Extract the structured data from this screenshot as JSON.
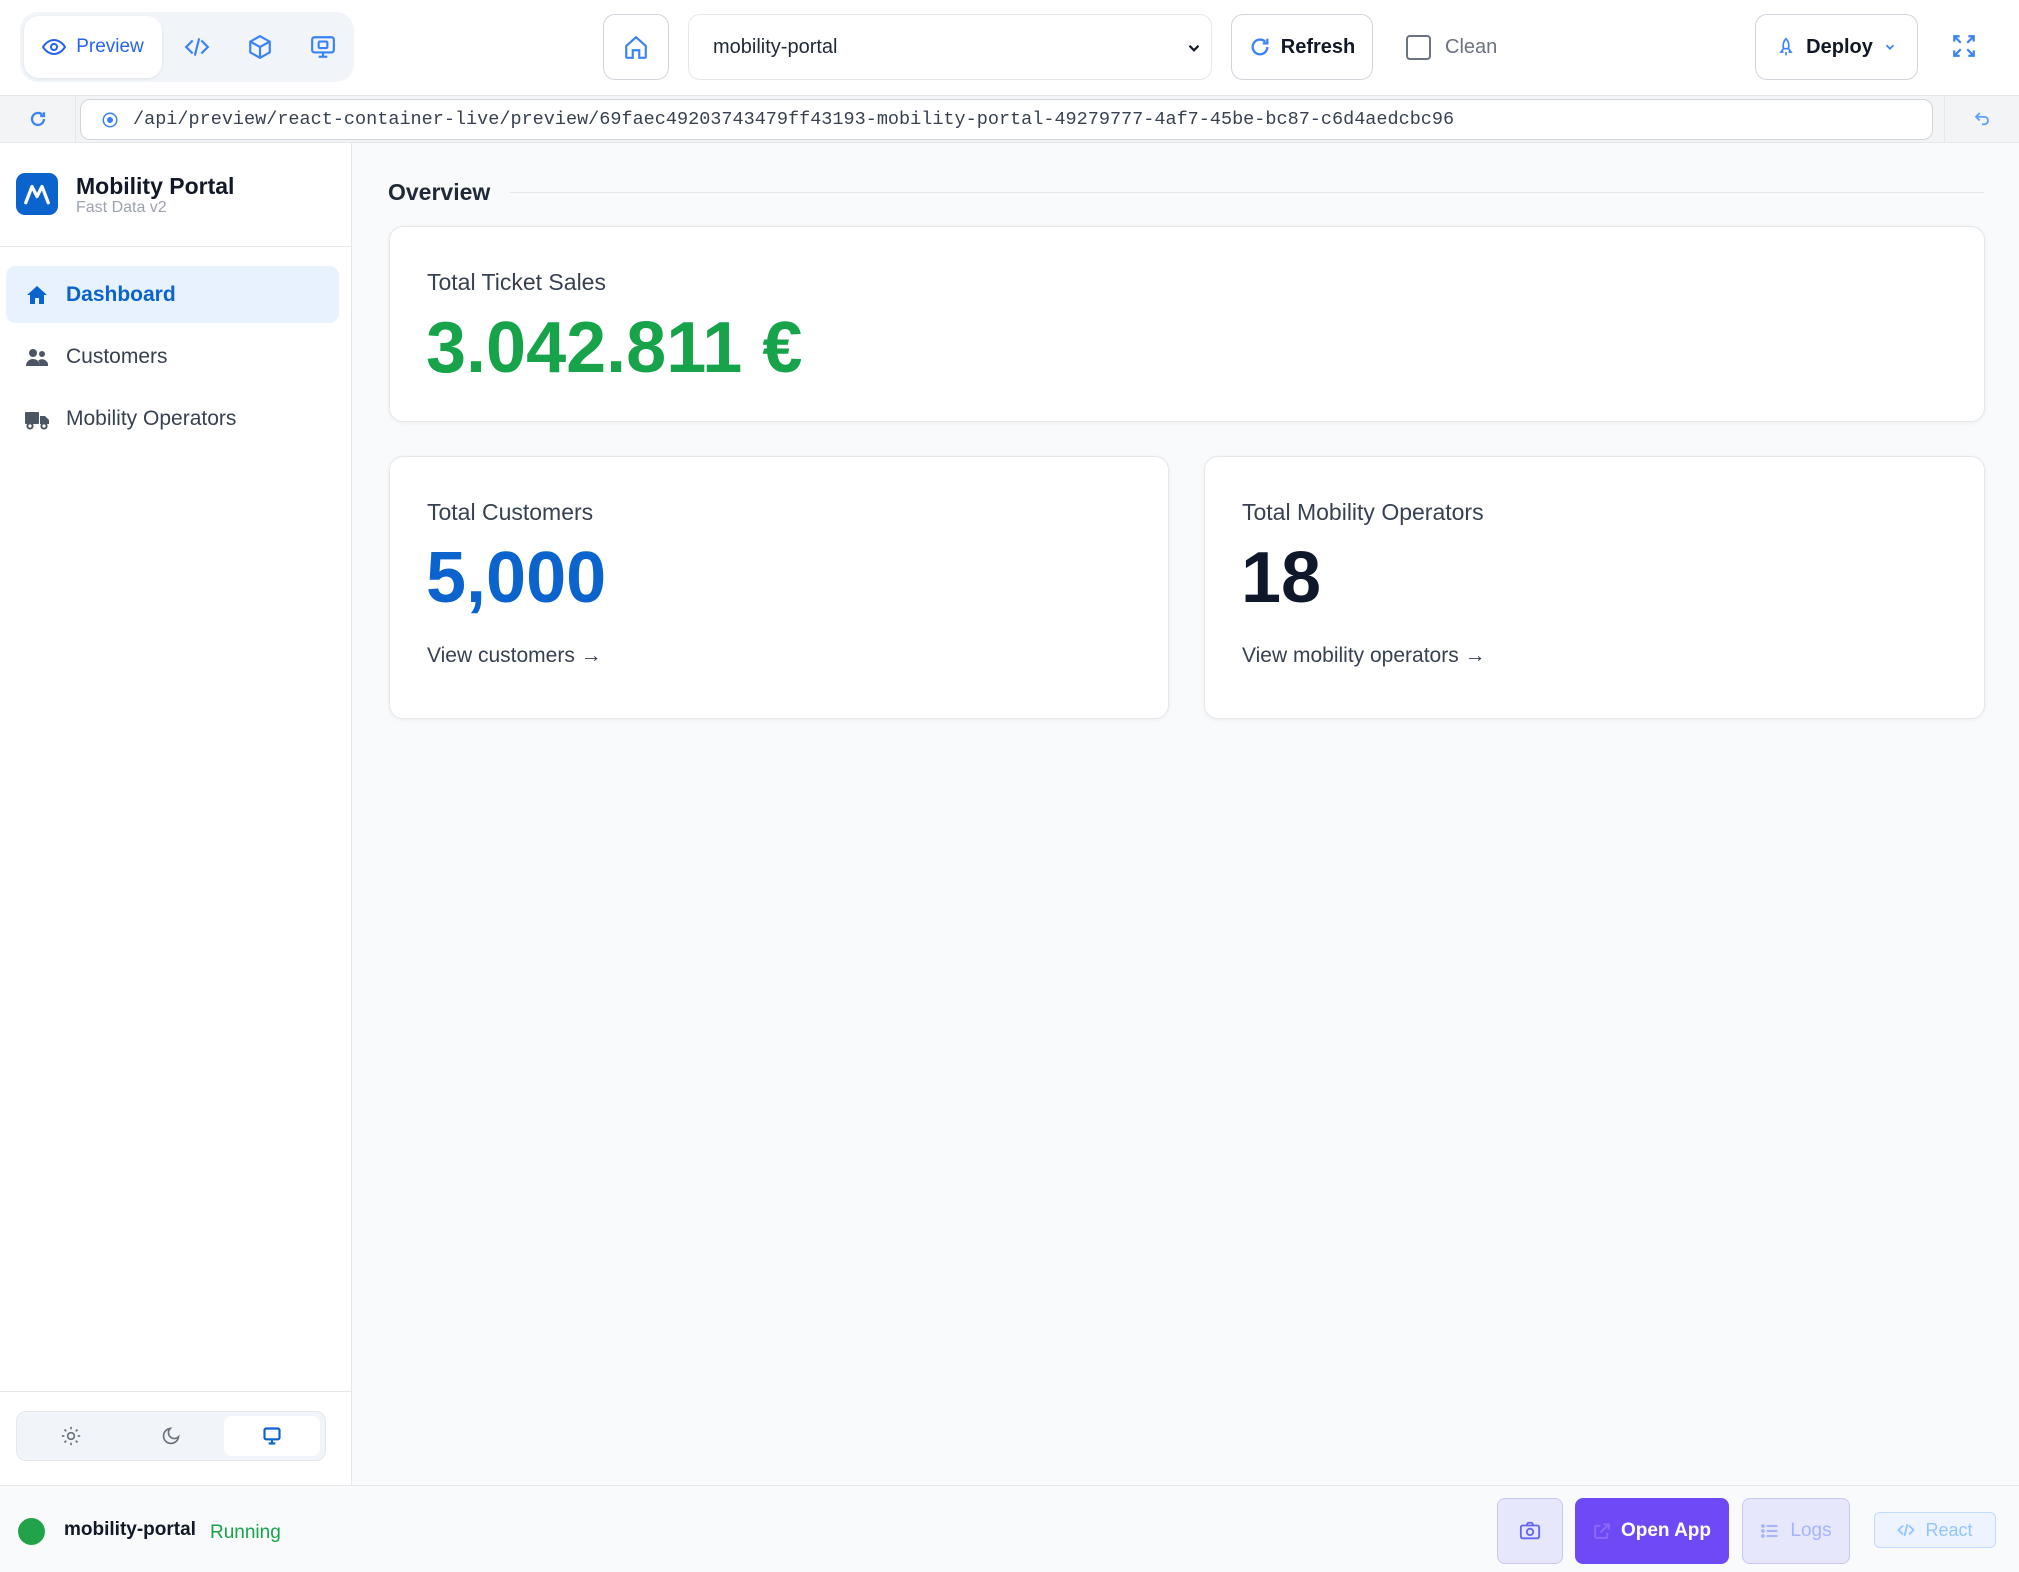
{
  "toolbar": {
    "view_modes": {
      "preview_label": "Preview",
      "preview_icon": "eye-icon",
      "code_icon": "code-icon",
      "box_icon": "cube-icon",
      "monitor_icon": "monitor-icon"
    },
    "home_icon": "home-icon",
    "project_select": {
      "value": "mobility-portal"
    },
    "refresh_label": "Refresh",
    "clean_label": "Clean",
    "clean_checked": false,
    "deploy_label": "Deploy",
    "fullscreen_icon": "expand-icon"
  },
  "address_bar": {
    "url": "/api/preview/react-container-live/preview/69faec49203743479ff43193-mobility-portal-49279777-4af7-45be-bc87-c6d4aedcbc96"
  },
  "sidebar": {
    "brand_title": "Mobility Portal",
    "brand_subtitle": "Fast Data v2",
    "items": [
      {
        "label": "Dashboard",
        "icon": "home-icon",
        "active": true
      },
      {
        "label": "Customers",
        "icon": "users-icon",
        "active": false
      },
      {
        "label": "Mobility Operators",
        "icon": "truck-icon",
        "active": false
      }
    ],
    "theme_options": [
      {
        "icon": "sun-icon",
        "active": false
      },
      {
        "icon": "moon-icon",
        "active": false
      },
      {
        "icon": "monitor-icon",
        "active": true
      }
    ]
  },
  "main": {
    "section_title": "Overview",
    "ticket_sales": {
      "label": "Total Ticket Sales",
      "value": "3.042.811 €",
      "color": "#16a34a"
    },
    "customers": {
      "label": "Total Customers",
      "value": "5,000",
      "link": "View customers →",
      "color": "#0b63ce"
    },
    "operators": {
      "label": "Total Mobility Operators",
      "value": "18",
      "link": "View mobility operators →",
      "color": "#0f172a"
    }
  },
  "status_bar": {
    "app_name": "mobility-portal",
    "status": "Running",
    "open_app_label": "Open App",
    "logs_label": "Logs",
    "react_label": "React"
  },
  "colors": {
    "accent": "#0b63ce",
    "toolbar_accent": "#3b82f6",
    "open_app": "#6d4af5",
    "running": "#16a34a"
  }
}
